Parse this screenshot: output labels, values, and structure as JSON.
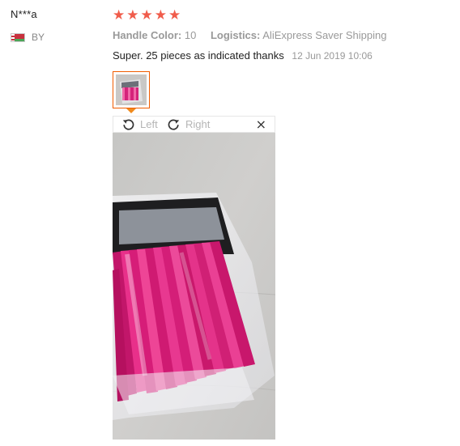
{
  "review": {
    "user": {
      "name": "N***a",
      "country_code": "BY",
      "flag_icon": "belarus-flag-icon"
    },
    "rating": {
      "stars": 5,
      "max": 5,
      "star_glyph": "★",
      "star_color": "#f05c4b"
    },
    "properties": [
      {
        "key": "Handle Color:",
        "value": "10"
      },
      {
        "key": "Logistics:",
        "value": "AliExpress Saver Shipping"
      }
    ],
    "text": "Super. 25 pieces as indicated thanks",
    "date": "12 Jun 2019 10:06",
    "thumbnail": {
      "icon": "photo-thumbnail",
      "border_color": "#f05c00",
      "selected": true
    }
  },
  "viewer": {
    "rotate_left_label": "Left",
    "rotate_right_label": "Right",
    "close_glyph": "×",
    "rotate_left_icon": "rotate-left-icon",
    "rotate_right_icon": "rotate-right-icon",
    "close_icon": "close-icon"
  },
  "colors": {
    "accent": "#f05c4b",
    "muted_text": "#999999",
    "thumb_border": "#f05c00",
    "brush_pink": "#e0207a"
  }
}
